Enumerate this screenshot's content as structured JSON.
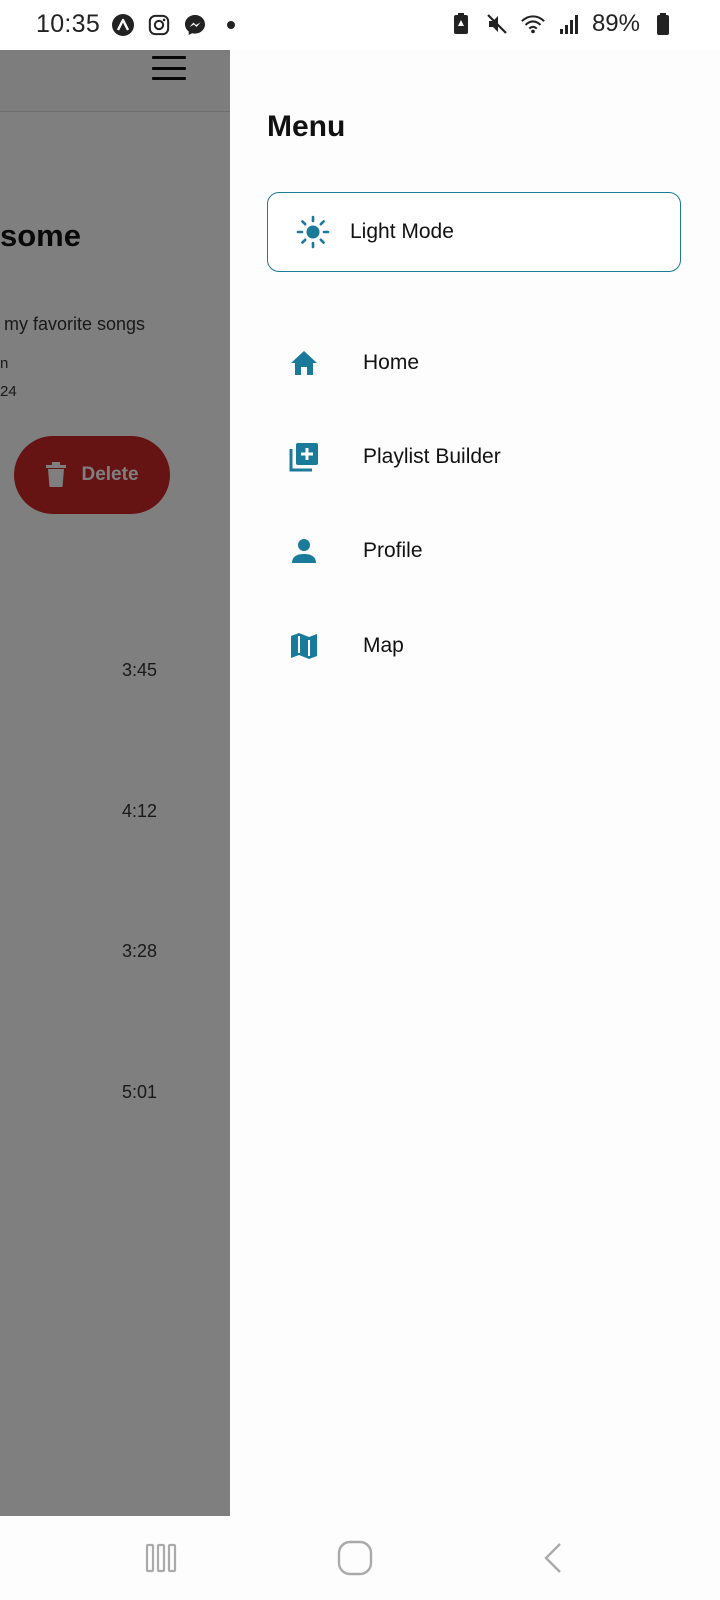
{
  "status_bar": {
    "time": "10:35",
    "battery_percent": "89%",
    "left_icons": [
      "app-a-icon",
      "instagram-icon",
      "messenger-icon",
      "dot-icon"
    ],
    "right_icons": [
      "battery-saver-icon",
      "mute-icon",
      "wifi-icon",
      "signal-icon",
      "battery-icon"
    ]
  },
  "background_app": {
    "title_fragment": "some",
    "description_fragment": "my favorite songs",
    "meta_line1": "n",
    "meta_line2": "24",
    "delete_label": "Delete",
    "durations": [
      "3:45",
      "4:12",
      "3:28",
      "5:01"
    ]
  },
  "drawer": {
    "title": "Menu",
    "mode_toggle": {
      "label": "Light Mode",
      "icon": "sun-icon"
    },
    "items": [
      {
        "label": "Home",
        "icon": "home-icon"
      },
      {
        "label": "Playlist Builder",
        "icon": "playlist-add-icon"
      },
      {
        "label": "Profile",
        "icon": "person-icon"
      },
      {
        "label": "Map",
        "icon": "map-icon"
      }
    ]
  },
  "colors": {
    "accent": "#1a7a9a",
    "delete": "#cc2727",
    "scrim": "rgba(0,0,0,0.5)"
  },
  "system_nav": [
    "recents-button",
    "home-button",
    "back-button"
  ]
}
